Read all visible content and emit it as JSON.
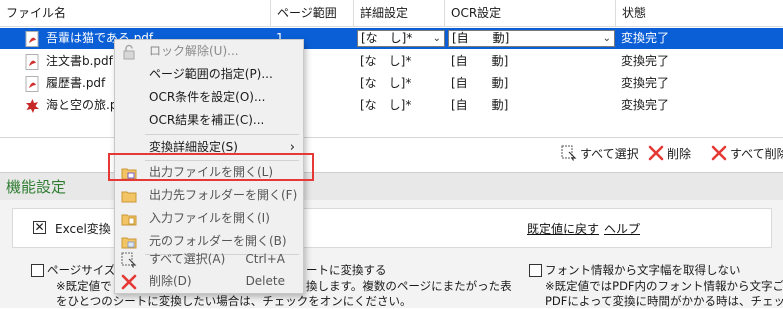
{
  "table": {
    "headers": [
      "ファイル名",
      "ページ範囲",
      "詳細設定",
      "OCR設定",
      "状態"
    ],
    "rows": [
      {
        "file": "吾輩は猫である.pdf",
        "pages": "1",
        "detail": "[な　し]*",
        "ocr": "[自　　動]",
        "status": "変換完了",
        "icon": "pdf-icon",
        "selected": true
      },
      {
        "file": "注文書b.pdf",
        "pages": "",
        "detail": "[な　し]*",
        "ocr": "[自　　動]",
        "status": "変換完了",
        "icon": "pdf-icon"
      },
      {
        "file": "履歴書.pdf",
        "pages": "",
        "detail": "[な　し]*",
        "ocr": "[自　　動]",
        "status": "変換完了",
        "icon": "pdf-icon"
      },
      {
        "file": "海と空の旅.pdf",
        "pages": "",
        "detail": "[な　し]*",
        "ocr": "[自　　動]",
        "status": "変換完了",
        "icon": "pdf-special-icon"
      }
    ]
  },
  "toolbar": {
    "select_all": "すべて選択",
    "delete": "削除",
    "delete_all": "すべて削除"
  },
  "panel": {
    "title": "機能設定",
    "excel_label": "Excel変換",
    "reset_default": "既定値に戻す",
    "help": "ヘルプ",
    "option1_label": "ページサイズと",
    "option1_mid": "ートに変換する",
    "option1_desc1": "※既定値で",
    "option1_desc1b": "換します。複数のページにまたがった表",
    "option1_desc2": "をひとつのシートに変換したい場合は、チェックをオンにください。",
    "option2_label": "フォント情報から文字幅を取得しない",
    "option2_desc1": "※既定値ではPDF内のフォント情報から文字ご",
    "option2_desc2": "PDFによって変換に時間がかかる時は、チェックを"
  },
  "menu": {
    "items": [
      {
        "label": "ロック解除(U)...",
        "state": "disabled",
        "icon": "lock-icon"
      },
      {
        "label": "ページ範囲の指定(P)...",
        "state": "normal"
      },
      {
        "label": "OCR条件を設定(O)...",
        "state": "normal"
      },
      {
        "label": "OCR結果を補正(C)...",
        "state": "normal"
      },
      {
        "label": "変換詳細設定(S)",
        "state": "normal",
        "submenu": true
      },
      {
        "label": "出力ファイルを開く(L)",
        "state": "dim",
        "icon": "output-file-icon"
      },
      {
        "label": "出力先フォルダーを開く(F)",
        "state": "dim",
        "icon": "output-folder-icon"
      },
      {
        "label": "入力ファイルを開く(I)",
        "state": "dim",
        "icon": "input-file-icon"
      },
      {
        "label": "元のフォルダーを開く(B)",
        "state": "dim",
        "icon": "source-folder-icon"
      },
      {
        "label": "すべて選択(A)",
        "state": "dim",
        "shortcut": "Ctrl+A",
        "icon": "select-all-icon"
      },
      {
        "label": "削除(D)",
        "state": "dim",
        "shortcut": "Delete",
        "icon": "delete-icon"
      }
    ],
    "submenu_arrow": "›",
    "highlighted_index": 5
  },
  "colors": {
    "selection": "#0a5fd7",
    "pdf_red": "#d32f2f",
    "panel_title": "#2f7d32",
    "highlight_box": "#e53935"
  }
}
